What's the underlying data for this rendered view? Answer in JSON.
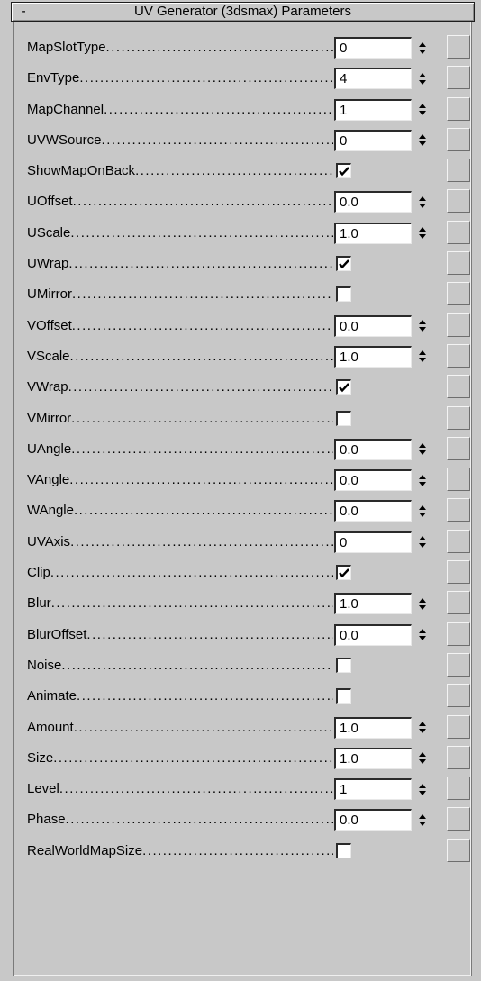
{
  "rollout": {
    "title": "UV Generator (3dsmax) Parameters",
    "toggle": "-"
  },
  "dots": "..........................................................",
  "params": [
    {
      "label": "MapSlotType",
      "type": "spinner",
      "value": "0"
    },
    {
      "label": "EnvType",
      "type": "spinner",
      "value": "4"
    },
    {
      "label": "MapChannel",
      "type": "spinner",
      "value": "1"
    },
    {
      "label": "UVWSource",
      "type": "spinner",
      "value": "0"
    },
    {
      "label": "ShowMapOnBack",
      "type": "checkbox",
      "checked": true
    },
    {
      "label": "UOffset",
      "type": "spinner",
      "value": "0.0"
    },
    {
      "label": "UScale",
      "type": "spinner",
      "value": "1.0"
    },
    {
      "label": "UWrap",
      "type": "checkbox",
      "checked": true
    },
    {
      "label": "UMirror",
      "type": "checkbox",
      "checked": false
    },
    {
      "label": "VOffset",
      "type": "spinner",
      "value": "0.0"
    },
    {
      "label": "VScale",
      "type": "spinner",
      "value": "1.0"
    },
    {
      "label": "VWrap",
      "type": "checkbox",
      "checked": true
    },
    {
      "label": "VMirror",
      "type": "checkbox",
      "checked": false
    },
    {
      "label": "UAngle",
      "type": "spinner",
      "value": "0.0"
    },
    {
      "label": "VAngle",
      "type": "spinner",
      "value": "0.0"
    },
    {
      "label": "WAngle",
      "type": "spinner",
      "value": "0.0"
    },
    {
      "label": "UVAxis",
      "type": "spinner",
      "value": "0"
    },
    {
      "label": "Clip",
      "type": "checkbox",
      "checked": true
    },
    {
      "label": "Blur",
      "type": "spinner",
      "value": "1.0"
    },
    {
      "label": "BlurOffset",
      "type": "spinner",
      "value": "0.0"
    },
    {
      "label": "Noise",
      "type": "checkbox",
      "checked": false
    },
    {
      "label": "Animate",
      "type": "checkbox",
      "checked": false
    },
    {
      "label": "Amount",
      "type": "spinner",
      "value": "1.0"
    },
    {
      "label": "Size",
      "type": "spinner",
      "value": "1.0"
    },
    {
      "label": "Level",
      "type": "spinner",
      "value": "1"
    },
    {
      "label": "Phase",
      "type": "spinner",
      "value": "0.0"
    },
    {
      "label": "RealWorldMapSize",
      "type": "checkbox",
      "checked": false
    }
  ],
  "colors": {
    "panel_bg": "#c8c8c8",
    "field_bg": "#ffffff",
    "text": "#000000"
  }
}
